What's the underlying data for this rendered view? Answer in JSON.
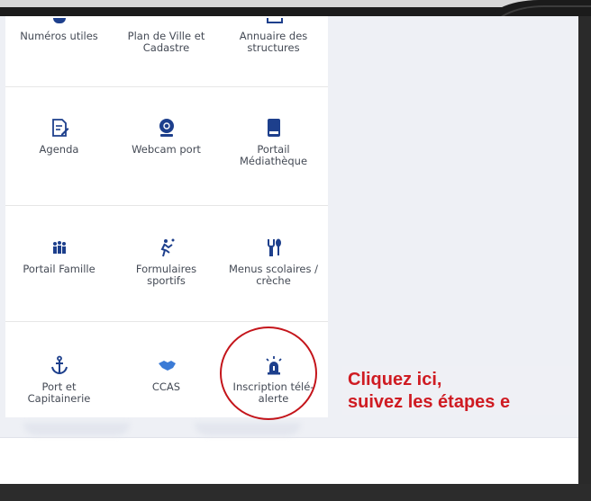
{
  "colors": {
    "icon": "#1d3f8c",
    "accent_red": "#cf1b22",
    "label": "#444a55",
    "background": "#eef0f5"
  },
  "grid": {
    "rows": [
      [
        {
          "label": "Numéros utiles",
          "icon": "phone-icon"
        },
        {
          "label": "Plan de Ville et Cadastre",
          "icon": "map-icon"
        },
        {
          "label": "Annuaire des structures",
          "icon": "directory-icon"
        }
      ],
      [
        {
          "label": "Agenda",
          "icon": "agenda-icon"
        },
        {
          "label": "Webcam port",
          "icon": "webcam-icon"
        },
        {
          "label": "Portail Médiathèque",
          "icon": "book-icon"
        }
      ],
      [
        {
          "label": "Portail Famille",
          "icon": "family-icon"
        },
        {
          "label": "Formulaires sportifs",
          "icon": "sport-icon"
        },
        {
          "label": "Menus scolaires / crèche",
          "icon": "cutlery-icon"
        }
      ],
      [
        {
          "label": "Port et Capitainerie",
          "icon": "anchor-icon"
        },
        {
          "label": "CCAS",
          "icon": "handshake-icon"
        },
        {
          "label": "Inscription télé-alerte",
          "icon": "alarm-light-icon"
        }
      ]
    ]
  },
  "callout": {
    "line1": "Cliquez ici,",
    "line2": "suivez les étapes e"
  }
}
